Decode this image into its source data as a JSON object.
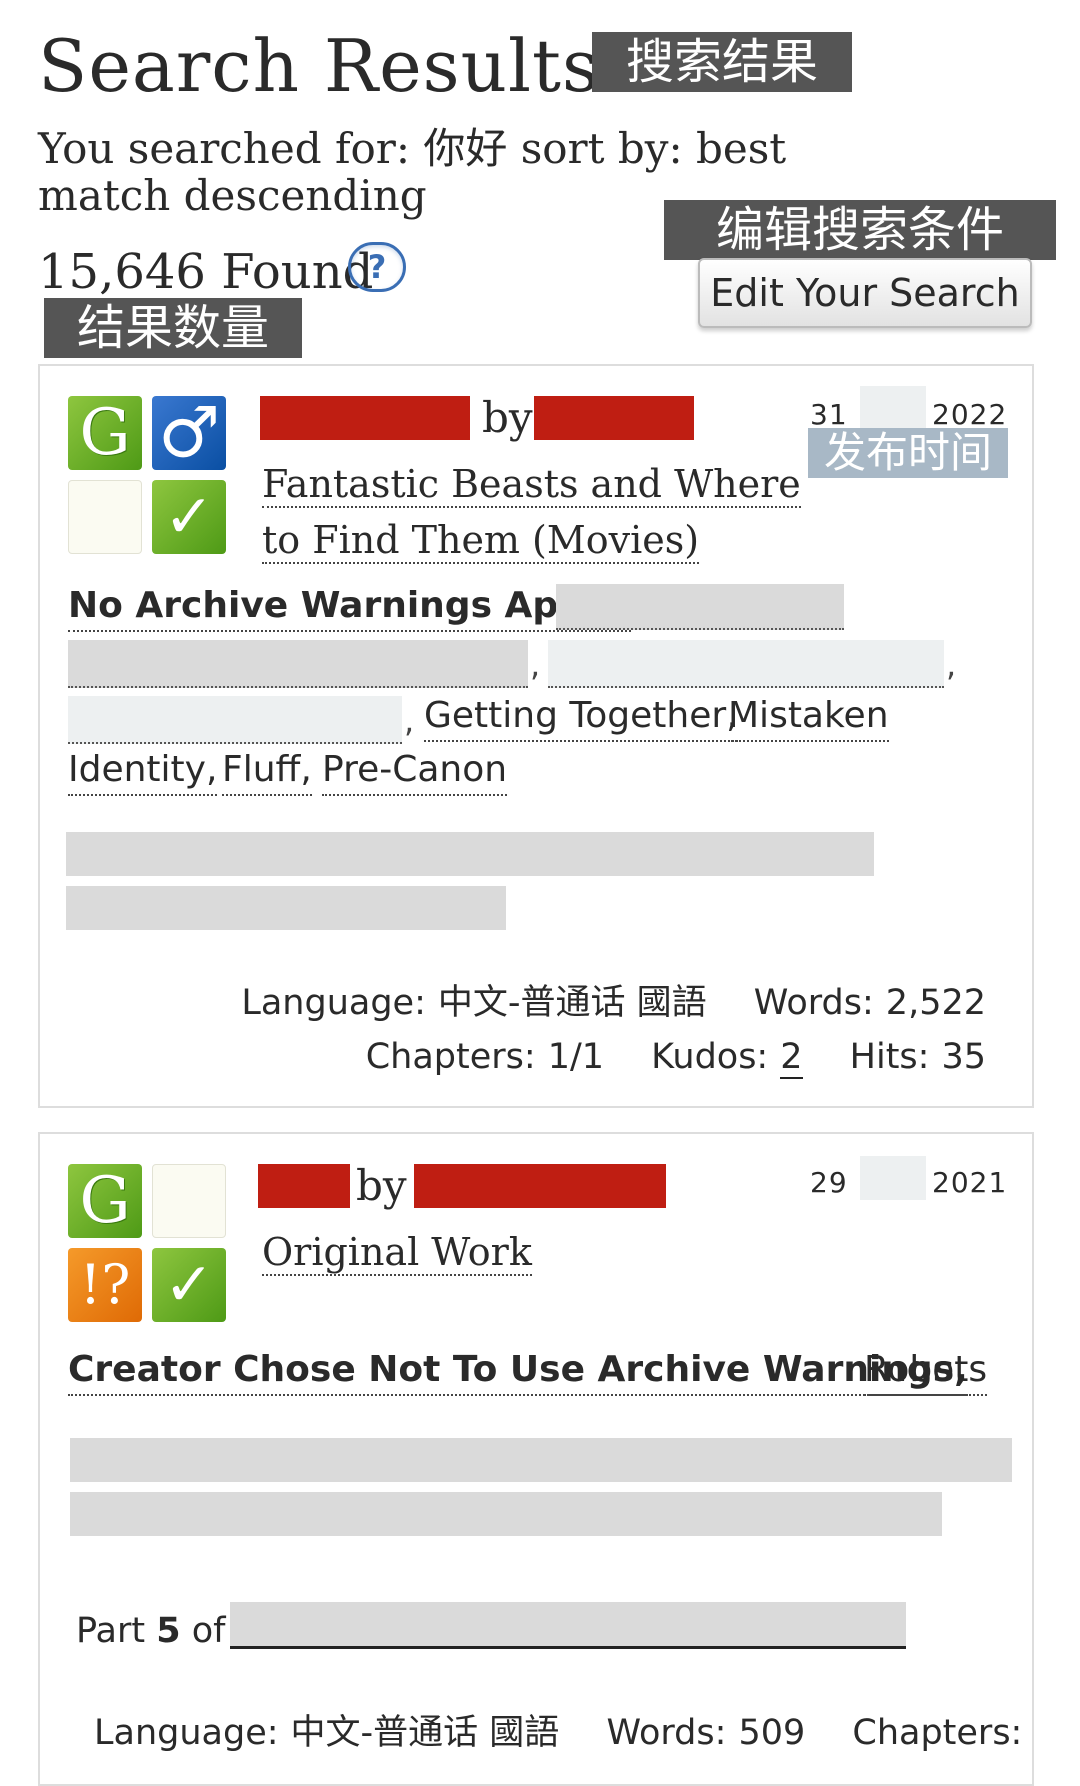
{
  "header": {
    "title": "Search Results",
    "title_cn": "搜索结果",
    "searched_line": "You searched for: 你好 sort by: best match descending",
    "found": "15,646 Found",
    "found_cn": "结果数量",
    "help_symbol": "?",
    "edit_cn": "编辑搜索条件",
    "edit_button": "Edit Your Search"
  },
  "works": [
    {
      "by": "by",
      "fandom": "Fantastic Beasts and Where to Find Them (Movies)",
      "date_day": "31",
      "date_year": "2022",
      "date_cn": "发布时间",
      "icons": [
        "rating-general-icon",
        "category-mm-icon",
        "warning-none-icon",
        "complete-icon"
      ],
      "rating_symbol": "G",
      "category_symbol": "♂",
      "complete_symbol": "✓",
      "tags": [
        "No Archive Warnings Apply,",
        "Getting Together,",
        "Mistaken",
        "Identity,",
        "Fluff,",
        "Pre-Canon"
      ],
      "stats": {
        "language_label": "Language:",
        "language": "中文-普通话 國語",
        "words_label": "Words:",
        "words": "2,522",
        "chapters_label": "Chapters:",
        "chapters": "1/1",
        "kudos_label": "Kudos:",
        "kudos": "2",
        "hits_label": "Hits:",
        "hits": "35"
      }
    },
    {
      "by": "by",
      "fandom": "Original Work",
      "date_day": "29",
      "date_year": "2021",
      "icons": [
        "rating-general-icon",
        "category-none-icon",
        "warning-choose-not-icon",
        "complete-icon"
      ],
      "rating_symbol": "G",
      "warning_symbol": "!?",
      "complete_symbol": "✓",
      "tags": [
        "Creator Chose Not To Use Archive Warnings,",
        "Robots"
      ],
      "series": {
        "part_prefix": "Part",
        "part_number": "5",
        "part_suffix": "of"
      },
      "stats": {
        "language_label": "Language:",
        "language": "中文-普通话 國語",
        "words_label": "Words:",
        "words": "509",
        "chapters_label": "Chapters:"
      }
    }
  ]
}
